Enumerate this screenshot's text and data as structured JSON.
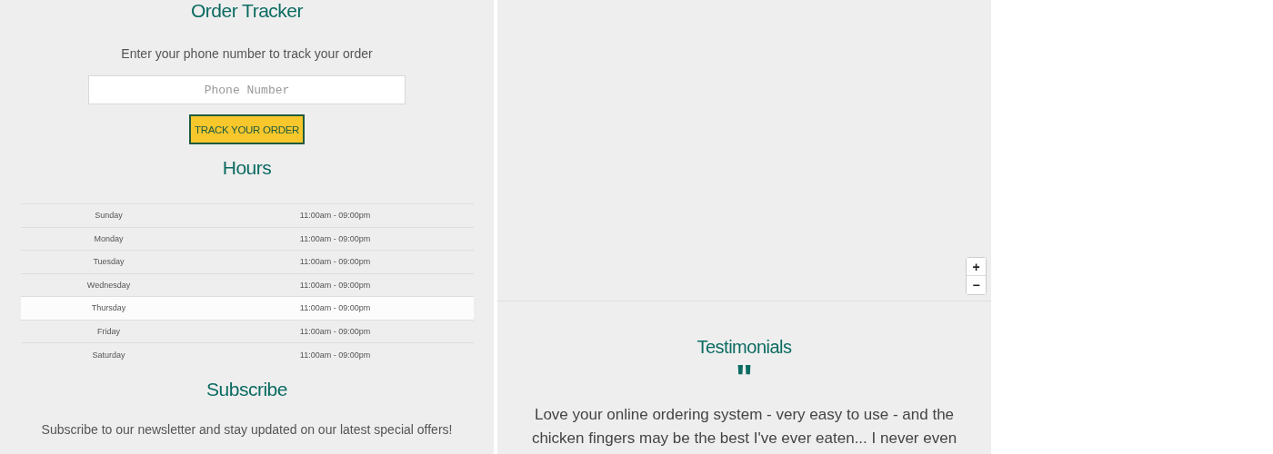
{
  "order_tracker": {
    "title": "Order Tracker",
    "description": "Enter your phone number to track your order",
    "phone_field": {
      "placeholder": "Phone Number"
    },
    "button": "TRACK YOUR ORDER"
  },
  "hours": {
    "title": "Hours",
    "rows": [
      {
        "day": "Sunday",
        "time": "11:00am - 09:00pm",
        "highlighted": false
      },
      {
        "day": "Monday",
        "time": "11:00am - 09:00pm",
        "highlighted": false
      },
      {
        "day": "Tuesday",
        "time": "11:00am - 09:00pm",
        "highlighted": false
      },
      {
        "day": "Wednesday",
        "time": "11:00am - 09:00pm",
        "highlighted": false
      },
      {
        "day": "Thursday",
        "time": "11:00am - 09:00pm",
        "highlighted": true
      },
      {
        "day": "Friday",
        "time": "11:00am - 09:00pm",
        "highlighted": false
      },
      {
        "day": "Saturday",
        "time": "11:00am - 09:00pm",
        "highlighted": false
      }
    ]
  },
  "subscribe": {
    "title": "Subscribe",
    "description": "Subscribe to our newsletter and stay updated on our latest special offers!"
  },
  "map": {
    "zoom_in": "+",
    "zoom_out": "−"
  },
  "testimonials": {
    "title": "Testimonials",
    "quote_mark": "\"",
    "text": "Love your online ordering system - very easy to use - and the chicken fingers may be the best I've ever eaten... I never even"
  }
}
